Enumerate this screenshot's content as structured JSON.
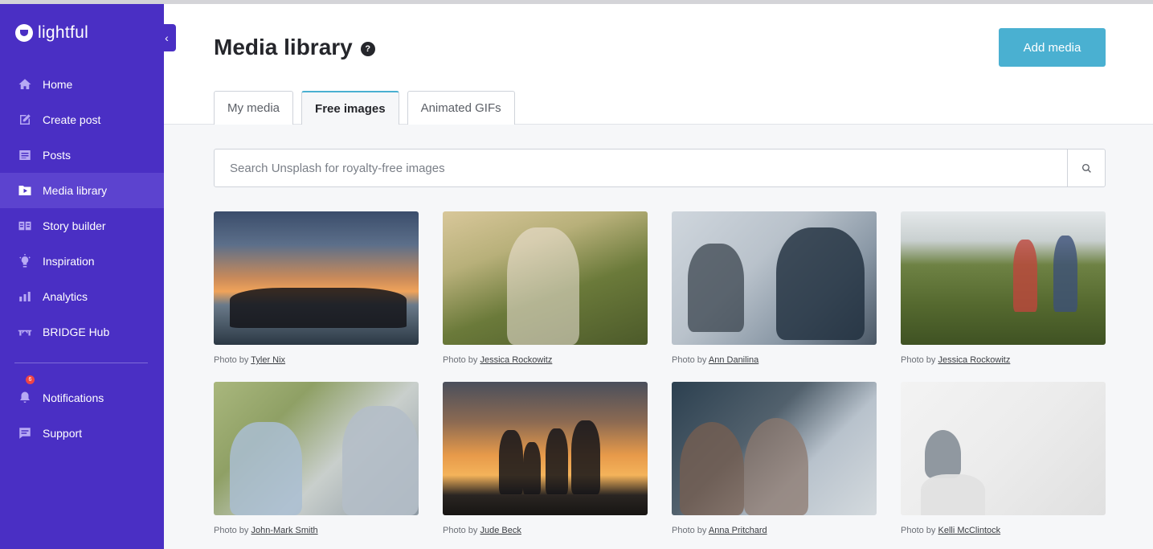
{
  "app": {
    "logo_text": "lightful"
  },
  "sidebar": {
    "collapse_icon": "chevron-left-icon",
    "items": [
      {
        "label": "Home",
        "icon": "home-icon",
        "active": false
      },
      {
        "label": "Create post",
        "icon": "edit-icon",
        "active": false
      },
      {
        "label": "Posts",
        "icon": "posts-icon",
        "active": false
      },
      {
        "label": "Media library",
        "icon": "media-icon",
        "active": true
      },
      {
        "label": "Story builder",
        "icon": "story-icon",
        "active": false
      },
      {
        "label": "Inspiration",
        "icon": "bulb-icon",
        "active": false
      },
      {
        "label": "Analytics",
        "icon": "chart-icon",
        "active": false
      },
      {
        "label": "BRIDGE Hub",
        "icon": "bridge-icon",
        "active": false
      }
    ],
    "secondary": [
      {
        "label": "Notifications",
        "icon": "bell-icon",
        "badge": "6"
      },
      {
        "label": "Support",
        "icon": "chat-icon"
      }
    ]
  },
  "header": {
    "title": "Media library",
    "help_glyph": "?",
    "add_button": "Add media"
  },
  "tabs": [
    {
      "label": "My media",
      "active": false
    },
    {
      "label": "Free images",
      "active": true
    },
    {
      "label": "Animated GIFs",
      "active": false
    }
  ],
  "search": {
    "placeholder": "Search Unsplash for royalty-free images"
  },
  "photos": [
    {
      "prefix": "Photo by ",
      "author": "Tyler Nix"
    },
    {
      "prefix": "Photo by ",
      "author": "Jessica Rockowitz"
    },
    {
      "prefix": "Photo by ",
      "author": "Ann Danilina"
    },
    {
      "prefix": "Photo by ",
      "author": "Jessica Rockowitz"
    },
    {
      "prefix": "Photo by ",
      "author": "John-Mark Smith"
    },
    {
      "prefix": "Photo by ",
      "author": "Jude Beck"
    },
    {
      "prefix": "Photo by ",
      "author": "Anna Pritchard"
    },
    {
      "prefix": "Photo by ",
      "author": "Kelli McClintock"
    }
  ],
  "colors": {
    "sidebar": "#4a2fc4",
    "accent": "#4ab0d1"
  }
}
